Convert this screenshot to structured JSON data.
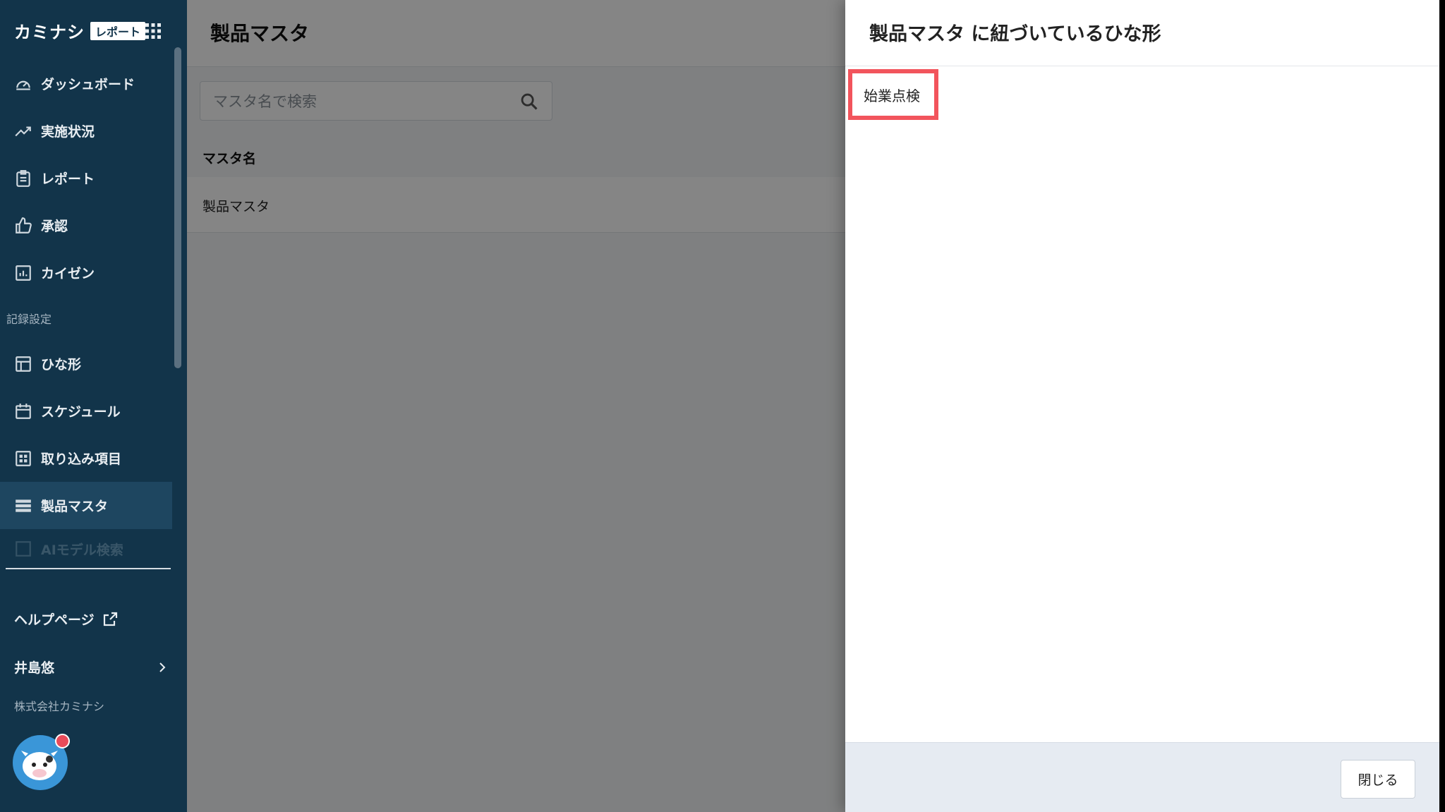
{
  "sidebar": {
    "logo_text": "カミナシ",
    "logo_badge": "レポート",
    "nav_main": [
      {
        "label": "ダッシュボード",
        "icon": "speedometer-icon"
      },
      {
        "label": "実施状況",
        "icon": "trend-icon"
      },
      {
        "label": "レポート",
        "icon": "clipboard-icon"
      },
      {
        "label": "承認",
        "icon": "thumbs-up-icon"
      },
      {
        "label": "カイゼン",
        "icon": "chart-icon"
      }
    ],
    "section_label": "記録設定",
    "nav_settings": [
      {
        "label": "ひな形",
        "icon": "template-icon"
      },
      {
        "label": "スケジュール",
        "icon": "calendar-icon"
      },
      {
        "label": "取り込み項目",
        "icon": "grid-icon"
      },
      {
        "label": "製品マスタ",
        "icon": "list-icon",
        "active": true
      },
      {
        "label": "AIモデル検索",
        "icon": "ai-icon"
      }
    ],
    "help_label": "ヘルプページ",
    "user_name": "井島悠",
    "company": "株式会社カミナシ"
  },
  "main": {
    "title": "製品マスタ",
    "search_placeholder": "マスタ名で検索",
    "table_header": "マスタ名",
    "rows": [
      "製品マスタ"
    ]
  },
  "drawer": {
    "title": "製品マスタ に紐づいているひな形",
    "items": [
      "始業点検"
    ],
    "close_label": "閉じる"
  },
  "colors": {
    "sidebar_bg": "#12344a",
    "highlight_border": "#f2545c",
    "footer_bg": "#e6ebf2"
  }
}
